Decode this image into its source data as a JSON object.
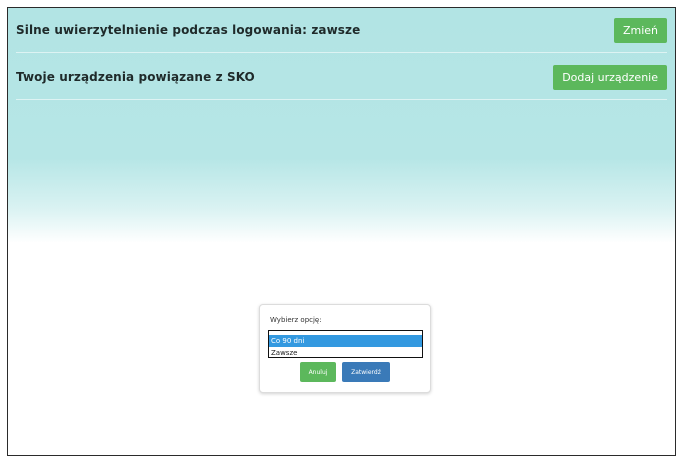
{
  "rows": [
    {
      "title": "Silne uwierzytelnienie podczas logowania: zawsze",
      "button": "Zmień"
    },
    {
      "title": "Twoje urządzenia powiązane z SKO",
      "button": "Dodaj urządzenie"
    }
  ],
  "dialog": {
    "label": "Wybierz opcję:",
    "options": [
      "Co 90 dni",
      "Zawsze"
    ],
    "selected": "Co 90 dni",
    "cancel": "Anuluj",
    "confirm": "Zatwierdź"
  },
  "colors": {
    "accent_green": "#5cb85c",
    "accent_blue": "#3a7ab8",
    "selection_blue": "#3399e0",
    "header_bg": "#b2e4e4"
  }
}
